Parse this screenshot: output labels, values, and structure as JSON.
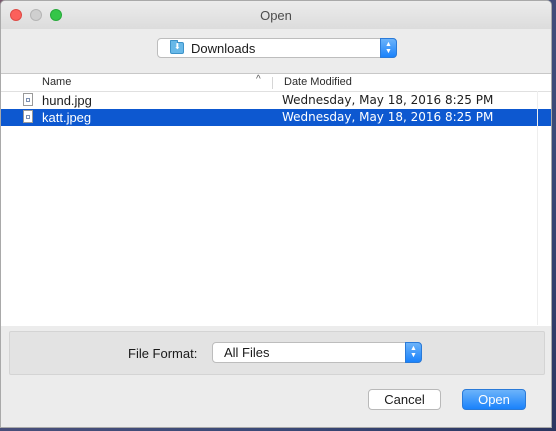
{
  "window": {
    "title": "Open"
  },
  "location": {
    "folder": "Downloads",
    "icon": "downloads-folder-icon"
  },
  "columns": {
    "name": "Name",
    "date": "Date Modified",
    "sort_indicator": "^"
  },
  "files": [
    {
      "name": "hund.jpg",
      "date": "Wednesday, May 18, 2016 8:25 PM",
      "selected": false
    },
    {
      "name": "katt.jpeg",
      "date": "Wednesday, May 18, 2016 8:25 PM",
      "selected": true
    }
  ],
  "format": {
    "label": "File Format:",
    "value": "All Files"
  },
  "buttons": {
    "cancel": "Cancel",
    "open": "Open"
  },
  "colors": {
    "accent": "#1a82fb",
    "selection": "#0d58d0",
    "close": "#fc605b",
    "maximize": "#35c648"
  }
}
